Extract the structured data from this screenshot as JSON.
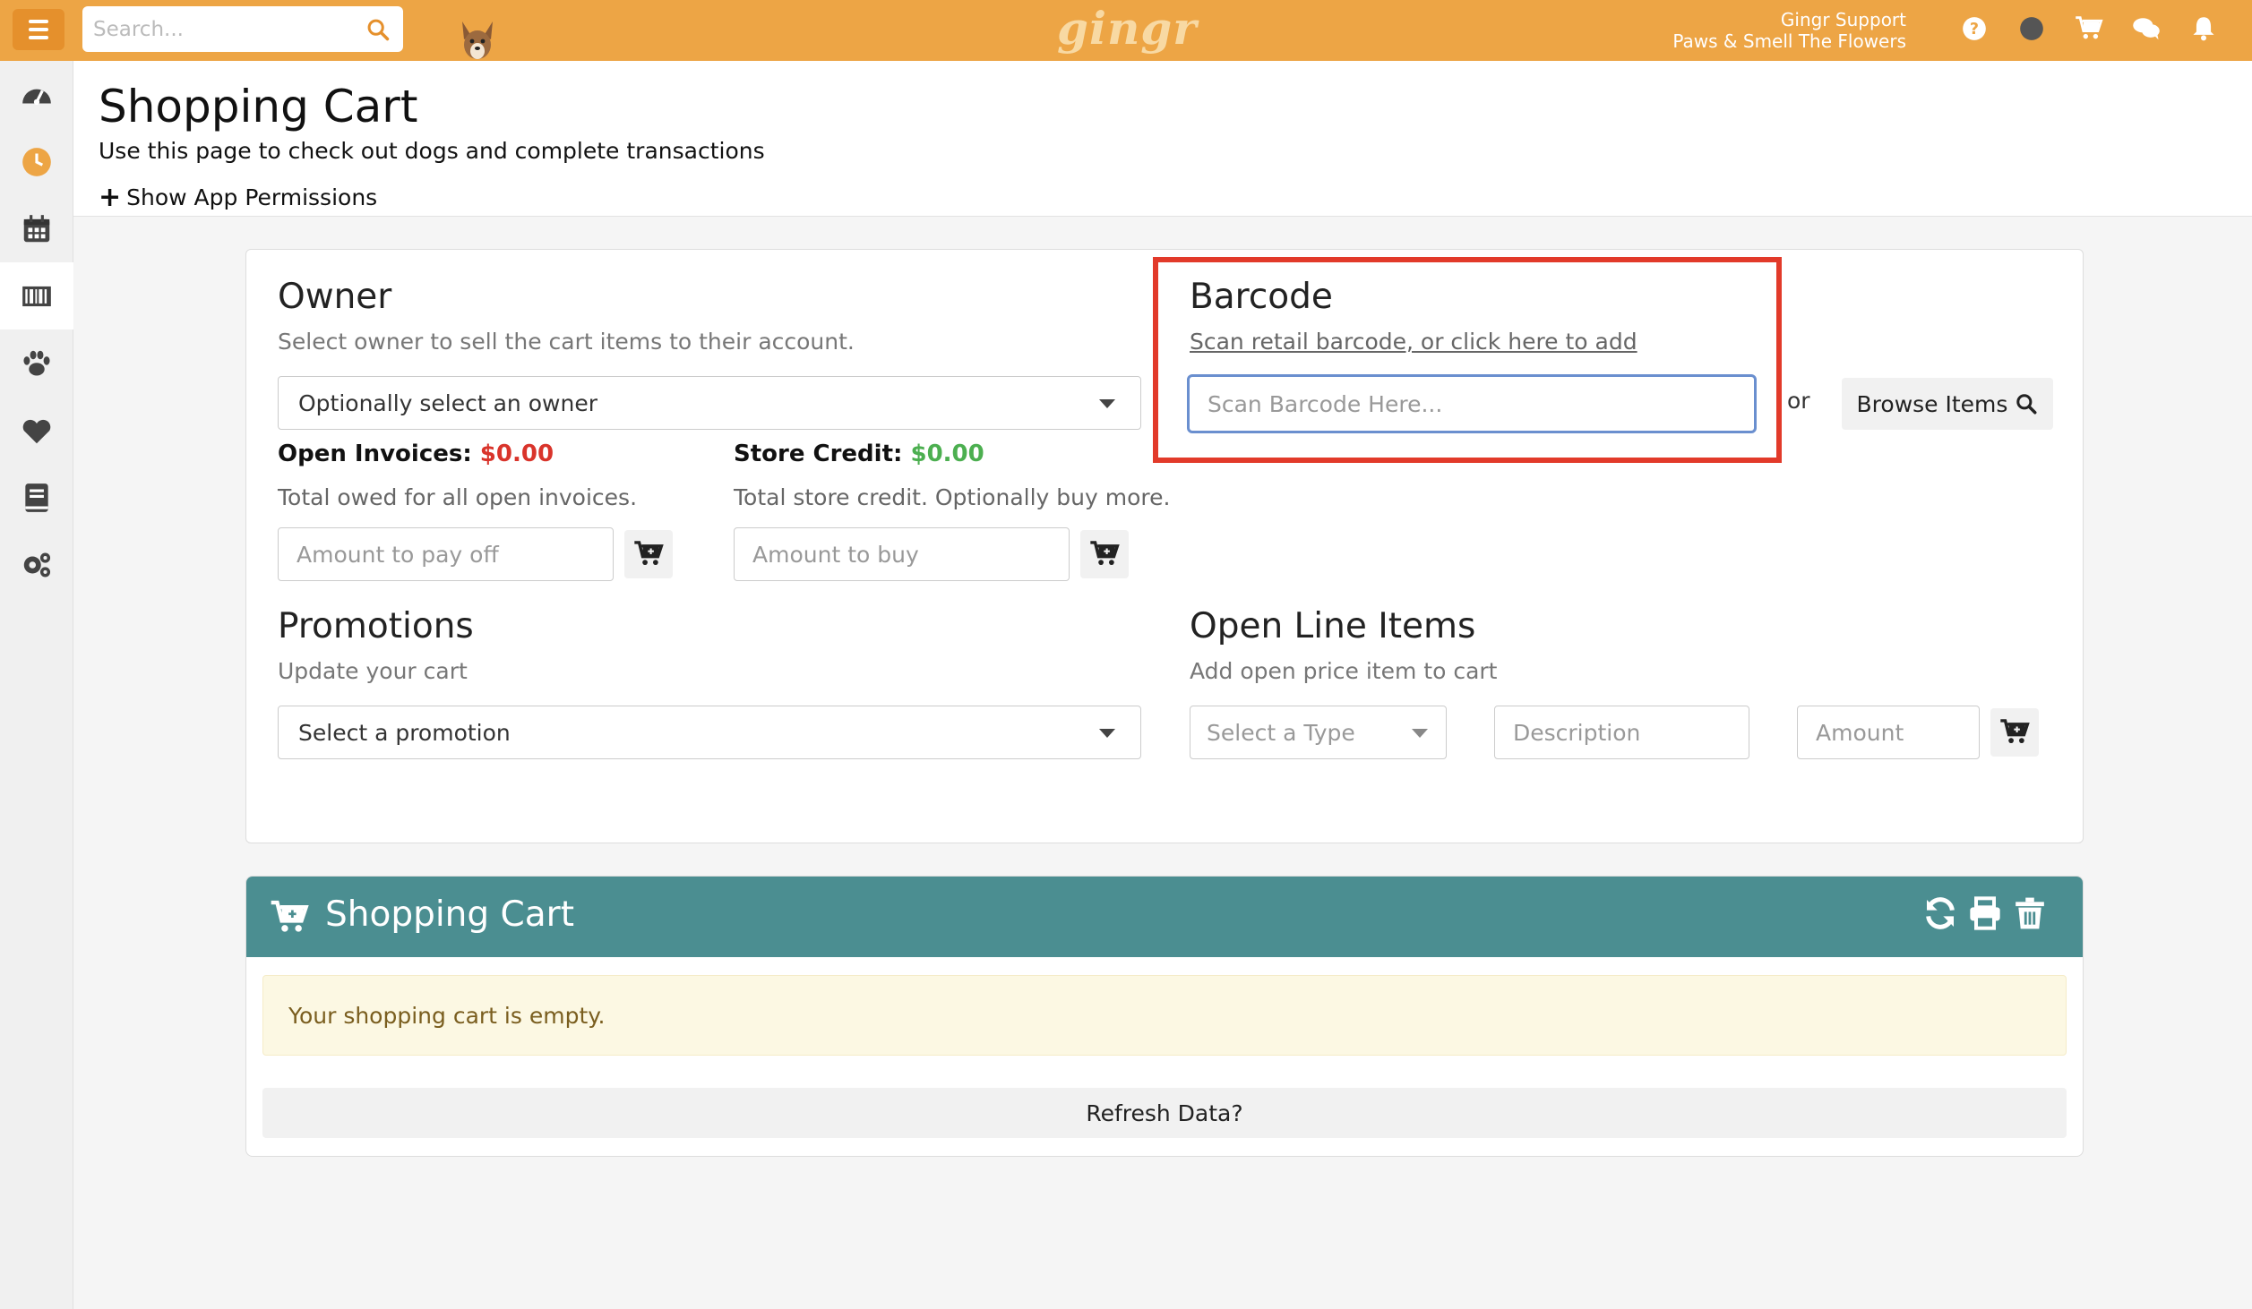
{
  "app": {
    "logo": "gingr",
    "search_placeholder": "Search...",
    "user_name": "Gingr Support",
    "user_location": "Paws & Smell The Flowers"
  },
  "top_icons": [
    "help-icon",
    "status-dot-icon",
    "cart-icon",
    "chat-icon",
    "bell-icon"
  ],
  "sidebar": {
    "items": [
      {
        "icon": "dashboard-icon"
      },
      {
        "icon": "clock-icon"
      },
      {
        "icon": "calendar-icon"
      },
      {
        "icon": "barcode-icon",
        "active": true
      },
      {
        "icon": "paw-icon"
      },
      {
        "icon": "heart-icon"
      },
      {
        "icon": "book-icon"
      },
      {
        "icon": "gears-icon"
      }
    ]
  },
  "header": {
    "title": "Shopping Cart",
    "subtitle": "Use this page to check out dogs and complete transactions",
    "permissions_link": "Show App Permissions"
  },
  "owner": {
    "title": "Owner",
    "description": "Select owner to sell the cart items to their account.",
    "select_value": "Optionally select an owner",
    "open_invoices_label": "Open Invoices:",
    "open_invoices_value": "$0.00",
    "open_invoices_desc": "Total owed for all open invoices.",
    "pay_placeholder": "Amount to pay off",
    "store_credit_label": "Store Credit:",
    "store_credit_value": "$0.00",
    "store_credit_desc": "Total store credit. Optionally buy more.",
    "buy_placeholder": "Amount to buy"
  },
  "barcode": {
    "title": "Barcode",
    "link": "Scan retail barcode, or click here to add",
    "input_placeholder": "Scan Barcode Here...",
    "or": "or",
    "browse_label": "Browse Items"
  },
  "promotions": {
    "title": "Promotions",
    "description": "Update your cart",
    "select_value": "Select a promotion"
  },
  "open_line_items": {
    "title": "Open Line Items",
    "description": "Add open price item to cart",
    "type_placeholder": "Select a Type",
    "description_placeholder": "Description",
    "amount_placeholder": "Amount"
  },
  "cart": {
    "title": "Shopping Cart",
    "empty_message": "Your shopping cart is empty.",
    "refresh_label": "Refresh Data?"
  },
  "colors": {
    "topbar": "#eda545",
    "cart_header": "#4b8e91",
    "highlight": "#e23a2a",
    "negative": "#d9342b",
    "positive": "#4caf50"
  }
}
